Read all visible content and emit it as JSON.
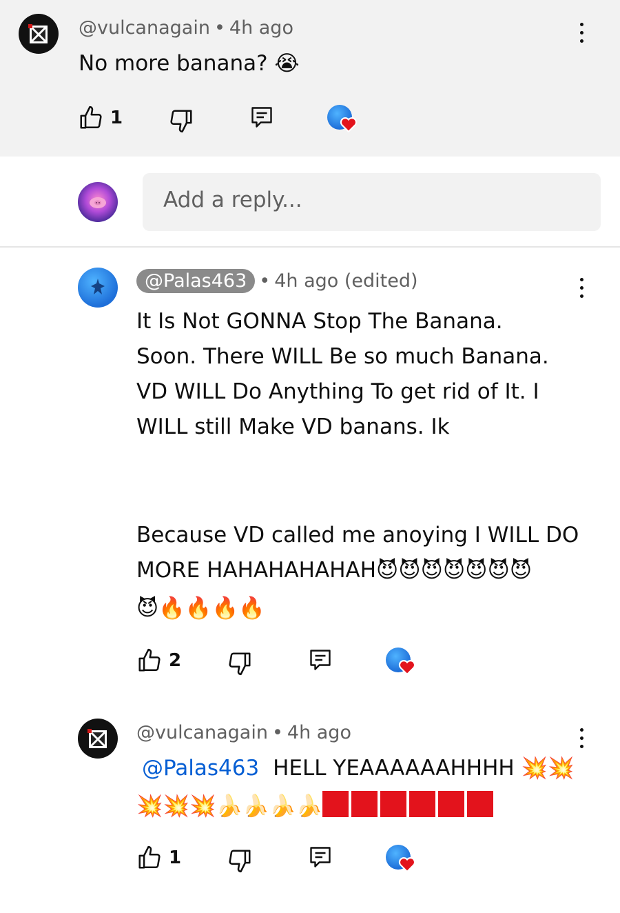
{
  "comments": [
    {
      "author": "@vulcanagain",
      "time": "4h ago",
      "text": "No more banana? 😭",
      "likes": "1"
    },
    {
      "author": "@Palas463",
      "time": "4h ago (edited)",
      "lines": [
        "It Is Not GONNA Stop The Banana.",
        "Soon. There WILL Be so much Banana.",
        "VD WILL Do Anything To get rid of It. I",
        "WILL still Make VD banans. Ik"
      ],
      "lines2_a": "Because VD called me anoying I WILL DO",
      "lines2_b": "MORE HAHAHAHAHAH😈😈😈😈😈😈😈",
      "lines2_c": "😈🔥🔥🔥🔥",
      "likes": "2"
    },
    {
      "author": "@vulcanagain",
      "time": "4h ago",
      "mention": "@Palas463",
      "text_a": "HELL YEAAAAAAHHHH 💥💥",
      "text_b": "💥💥💥🍌🍌🍌🍌",
      "likes": "1"
    }
  ],
  "reply": {
    "placeholder": "Add a reply..."
  },
  "separator": "•",
  "colors": {
    "accent": "#065fd4",
    "heart": "#e3131c",
    "badge": "#1e6fd9"
  }
}
